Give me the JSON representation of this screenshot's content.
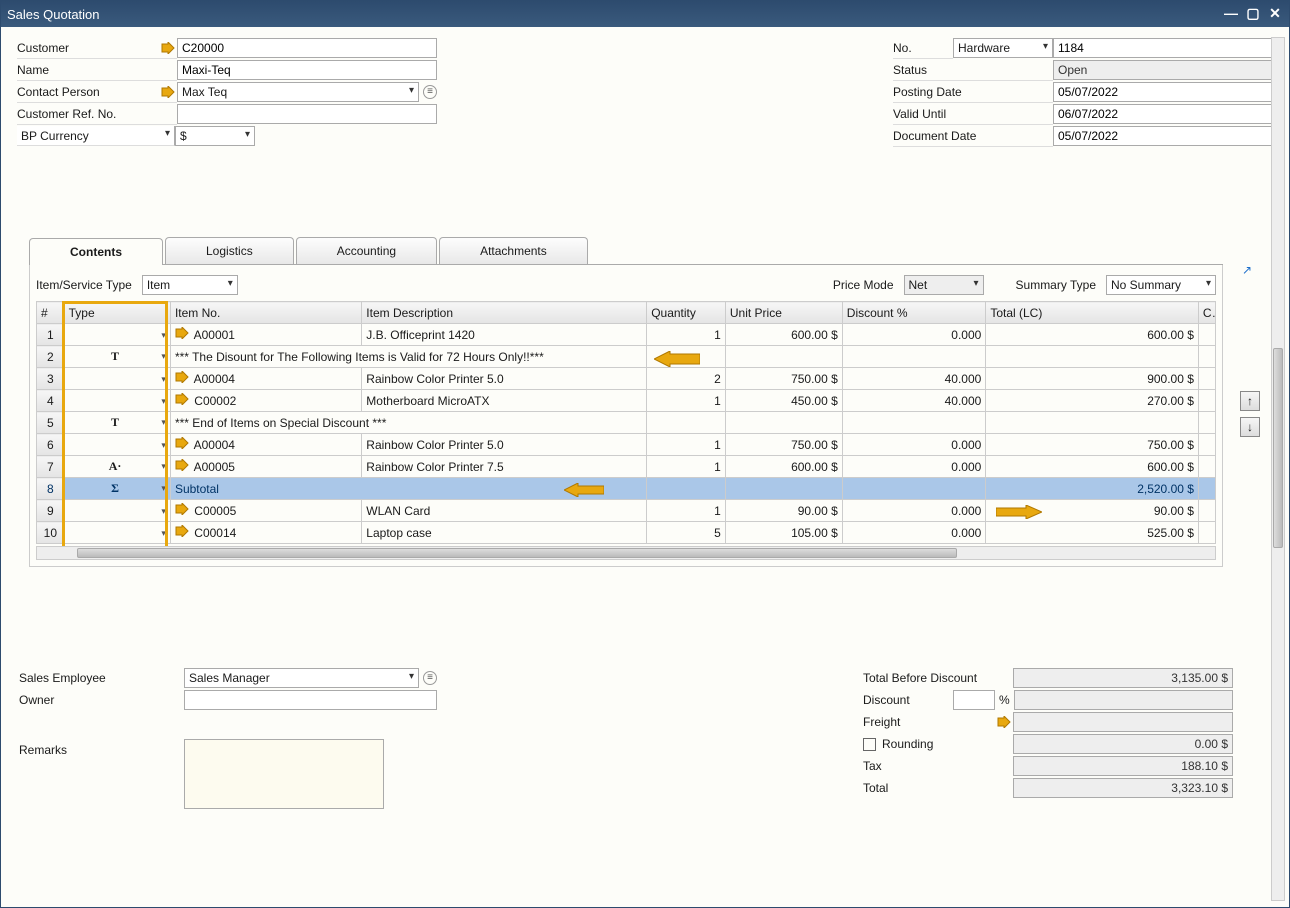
{
  "window": {
    "title": "Sales Quotation"
  },
  "header_left": {
    "customer_label": "Customer",
    "customer": "C20000",
    "name_label": "Name",
    "name": "Maxi-Teq",
    "contact_label": "Contact Person",
    "contact": "Max Teq",
    "custref_label": "Customer Ref. No.",
    "custref": "",
    "currency_label": "BP Currency",
    "currency_sym": "$"
  },
  "header_right": {
    "no_label": "No.",
    "series": "Hardware",
    "docnum": "1184",
    "status_label": "Status",
    "status": "Open",
    "posting_label": "Posting Date",
    "posting": "05/07/2022",
    "valid_label": "Valid Until",
    "valid": "06/07/2022",
    "docdate_label": "Document Date",
    "docdate": "05/07/2022"
  },
  "tabs": {
    "contents": "Contents",
    "logistics": "Logistics",
    "accounting": "Accounting",
    "attachments": "Attachments"
  },
  "subbar": {
    "itemservice_label": "Item/Service Type",
    "itemservice": "Item",
    "pricemode_label": "Price Mode",
    "pricemode": "Net",
    "summarytype_label": "Summary Type",
    "summarytype": "No Summary"
  },
  "grid": {
    "cols": {
      "num": "#",
      "type": "Type",
      "itemno": "Item No.",
      "desc": "Item Description",
      "qty": "Quantity",
      "price": "Unit Price",
      "disc": "Discount %",
      "total": "Total (LC)",
      "cut": "C"
    },
    "rows": [
      {
        "n": "1",
        "type": "",
        "link": true,
        "itemno": "A00001",
        "desc": "J.B. Officeprint 1420",
        "qty": "1",
        "price": "600.00 $",
        "disc": "0.000",
        "total": "600.00 $"
      },
      {
        "n": "2",
        "type": "T",
        "link": false,
        "itemno": "",
        "desc": "*** The Disount for The Following Items is Valid for 72 Hours Only!!***",
        "qty": "",
        "price": "",
        "disc": "",
        "total": ""
      },
      {
        "n": "3",
        "type": "",
        "link": true,
        "itemno": "A00004",
        "desc": "Rainbow Color Printer 5.0",
        "qty": "2",
        "price": "750.00 $",
        "disc": "40.000",
        "total": "900.00 $"
      },
      {
        "n": "4",
        "type": "",
        "link": true,
        "itemno": "C00002",
        "desc": "Motherboard MicroATX",
        "qty": "1",
        "price": "450.00 $",
        "disc": "40.000",
        "total": "270.00 $"
      },
      {
        "n": "5",
        "type": "T",
        "link": false,
        "itemno": "",
        "desc": "*** End of Items on Special Discount ***",
        "qty": "",
        "price": "",
        "disc": "",
        "total": ""
      },
      {
        "n": "6",
        "type": "",
        "link": true,
        "itemno": "A00004",
        "desc": "Rainbow Color Printer 5.0",
        "qty": "1",
        "price": "750.00 $",
        "disc": "0.000",
        "total": "750.00 $"
      },
      {
        "n": "7",
        "type": "A·",
        "link": true,
        "itemno": "A00005",
        "desc": "Rainbow Color Printer 7.5",
        "qty": "1",
        "price": "600.00 $",
        "disc": "0.000",
        "total": "600.00 $"
      },
      {
        "n": "8",
        "type": "Σ",
        "link": false,
        "itemno": "",
        "desc": "Subtotal",
        "qty": "",
        "price": "",
        "disc": "",
        "total": "2,520.00 $",
        "subtotal": true
      },
      {
        "n": "9",
        "type": "",
        "link": true,
        "itemno": "C00005",
        "desc": "WLAN Card",
        "qty": "1",
        "price": "90.00 $",
        "disc": "0.000",
        "total": "90.00 $"
      },
      {
        "n": "10",
        "type": "",
        "link": true,
        "itemno": "C00014",
        "desc": "Laptop case",
        "qty": "5",
        "price": "105.00 $",
        "disc": "0.000",
        "total": "525.00 $"
      }
    ]
  },
  "footer_left": {
    "sales_emp_label": "Sales Employee",
    "sales_emp": "Sales Manager",
    "owner_label": "Owner",
    "owner": "",
    "remarks_label": "Remarks",
    "remarks": ""
  },
  "totals": {
    "tbd_label": "Total Before Discount",
    "tbd": "3,135.00 $",
    "disc_label": "Discount",
    "disc_pct": "",
    "pct_sym": "%",
    "disc_amt": "",
    "freight_label": "Freight",
    "freight": "",
    "rounding_label": "Rounding",
    "rounding": "0.00 $",
    "tax_label": "Tax",
    "tax": "188.10 $",
    "total_label": "Total",
    "total": "3,323.10 $"
  }
}
